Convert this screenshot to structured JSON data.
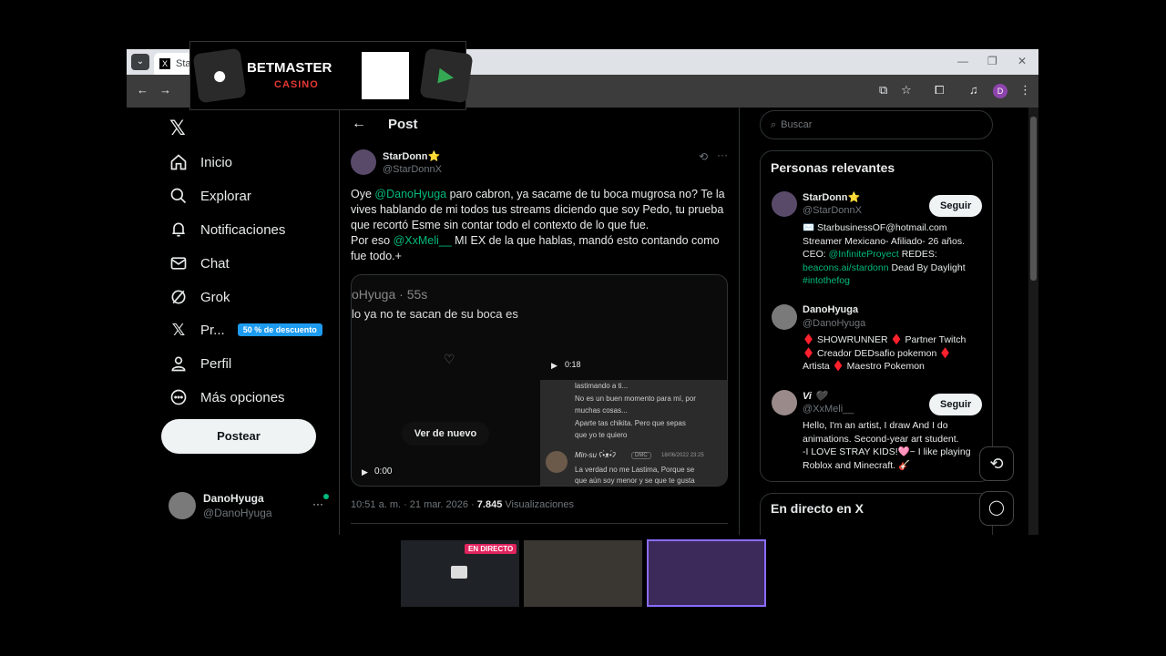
{
  "ad": {
    "brand": "BETMASTER",
    "sub": "CASINO"
  },
  "browser": {
    "tab_title": "Star",
    "profile_letter": "D"
  },
  "sidebar": {
    "items": [
      {
        "label": "Inicio",
        "icon": "home-icon"
      },
      {
        "label": "Explorar",
        "icon": "search-icon"
      },
      {
        "label": "Notificaciones",
        "icon": "bell-icon"
      },
      {
        "label": "Chat",
        "icon": "mail-icon"
      },
      {
        "label": "Grok",
        "icon": "grok-icon"
      },
      {
        "label": "Pr...",
        "icon": "x-icon",
        "badge": "50 % de descuento"
      },
      {
        "label": "Perfil",
        "icon": "person-icon"
      },
      {
        "label": "Más opciones",
        "icon": "more-circle-icon"
      }
    ],
    "post_button": "Postear",
    "account": {
      "name": "DanoHyuga",
      "handle": "@DanoHyuga"
    }
  },
  "post": {
    "header": "Post",
    "author": {
      "name": "StarDonn",
      "handle": "@StarDonnX"
    },
    "text1_a": "Oye ",
    "mention1": "@DanoHyuga",
    "text1_b": " paro cabron, ya sacame de tu boca mugrosa no? Te la vives hablando de mi todos tus streams diciendo que soy Pedo, tu prueba que recortó Esme sin contar todo el contexto de lo que fue.",
    "text2_a": "Por eso ",
    "mention2": "@XxMeli__",
    "text2_b": " MI EX de la que hablas, mandó esto contando como fue todo.+",
    "media": {
      "overlay_handle": "oHyuga · 55s",
      "overlay_line": "lo ya no te sacan de su boca es",
      "replay": "Ver de nuevo",
      "time_start": "0:00",
      "time_second": "0:18",
      "chat_lines": [
        "lastimando a ti...",
        "No es un buen momento para mí, por",
        "muchas cosas...",
        "Aparte tas chikita. Pero que sepas",
        "que yo te quiero"
      ],
      "chat_user": "Min-su ʕ•̀ᴥ•́ʔ",
      "chat_tag": "DMC",
      "chat_date": "18/06/2022 23:25",
      "chat_line2": "La verdad no me Lastima, Porque se",
      "chat_line3": "que aún soy menor y se que te gusta"
    },
    "meta_time": "10:51 a. m. · 21 mar. 2026 · ",
    "meta_views": "7.845",
    "meta_views_label": " Visualizaciones"
  },
  "right": {
    "search_placeholder": "Buscar",
    "relevant_title": "Personas relevantes",
    "people": [
      {
        "name": "StarDonn⭐",
        "handle": "@StarDonnX",
        "follow": "Seguir",
        "bio_1": "✉️ StarbusinessOF@hotmail.com",
        "bio_2": "Streamer Mexicano- Afiliado- 26 años.",
        "bio_3a": "CEO: ",
        "bio_3b": "@InfiniteProyect",
        "bio_3c": " REDES:",
        "bio_4a": "beacons.ai/stardonn",
        "bio_4b": " Dead By Daylight",
        "bio_5": "#intothefog"
      },
      {
        "name": "DanoHyuga",
        "handle": "@DanoHyuga",
        "bio_1": "♦️ SHOWRUNNER ♦️ Partner Twitch",
        "bio_2": "♦️ Creador DEDsafio pokemon ♦️",
        "bio_3": "Artista ♦️ Maestro Pokemon"
      },
      {
        "name": "Vi 🖤",
        "handle": "@XxMeli__",
        "follow": "Seguir",
        "bio_1": "Hello, I'm an artist, I draw And I do",
        "bio_2": "animations. Second-year art student.",
        "bio_3": "-I LOVE STRAY KIDS!🩷~ I like playing",
        "bio_4": "Roblox and Minecraft. 🎸"
      }
    ],
    "live_title": "En directo en X"
  },
  "overlay": {
    "live_badge": "EN DIRECTO"
  },
  "colors": {
    "accent": "#1d9bf0",
    "green_link": "#00ba7c",
    "badge_bg": "#1d9bf0",
    "live_red": "#e0245e"
  }
}
